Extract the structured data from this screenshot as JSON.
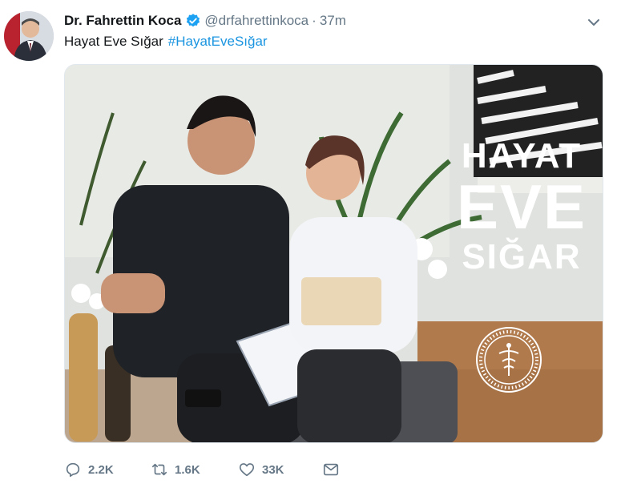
{
  "author": {
    "name": "Dr. Fahrettin Koca",
    "handle": "@drfahrettinkoca",
    "separator": "·",
    "time": "37m"
  },
  "tweet": {
    "text": "Hayat Eve Sığar",
    "hashtag": "#HayatEveSığar"
  },
  "media": {
    "overlay_line1": "HAYAT",
    "overlay_line2": "EVE",
    "overlay_line3": "SIĞAR"
  },
  "actions": {
    "replies": "2.2K",
    "retweets": "1.6K",
    "likes": "33K"
  },
  "colors": {
    "text": "#14171a",
    "secondary": "#657786",
    "link": "#1b95e0",
    "verified": "#1da1f2"
  },
  "icons": [
    "verified-badge-icon",
    "chevron-down-icon",
    "reply-icon",
    "retweet-icon",
    "like-icon",
    "message-icon"
  ]
}
